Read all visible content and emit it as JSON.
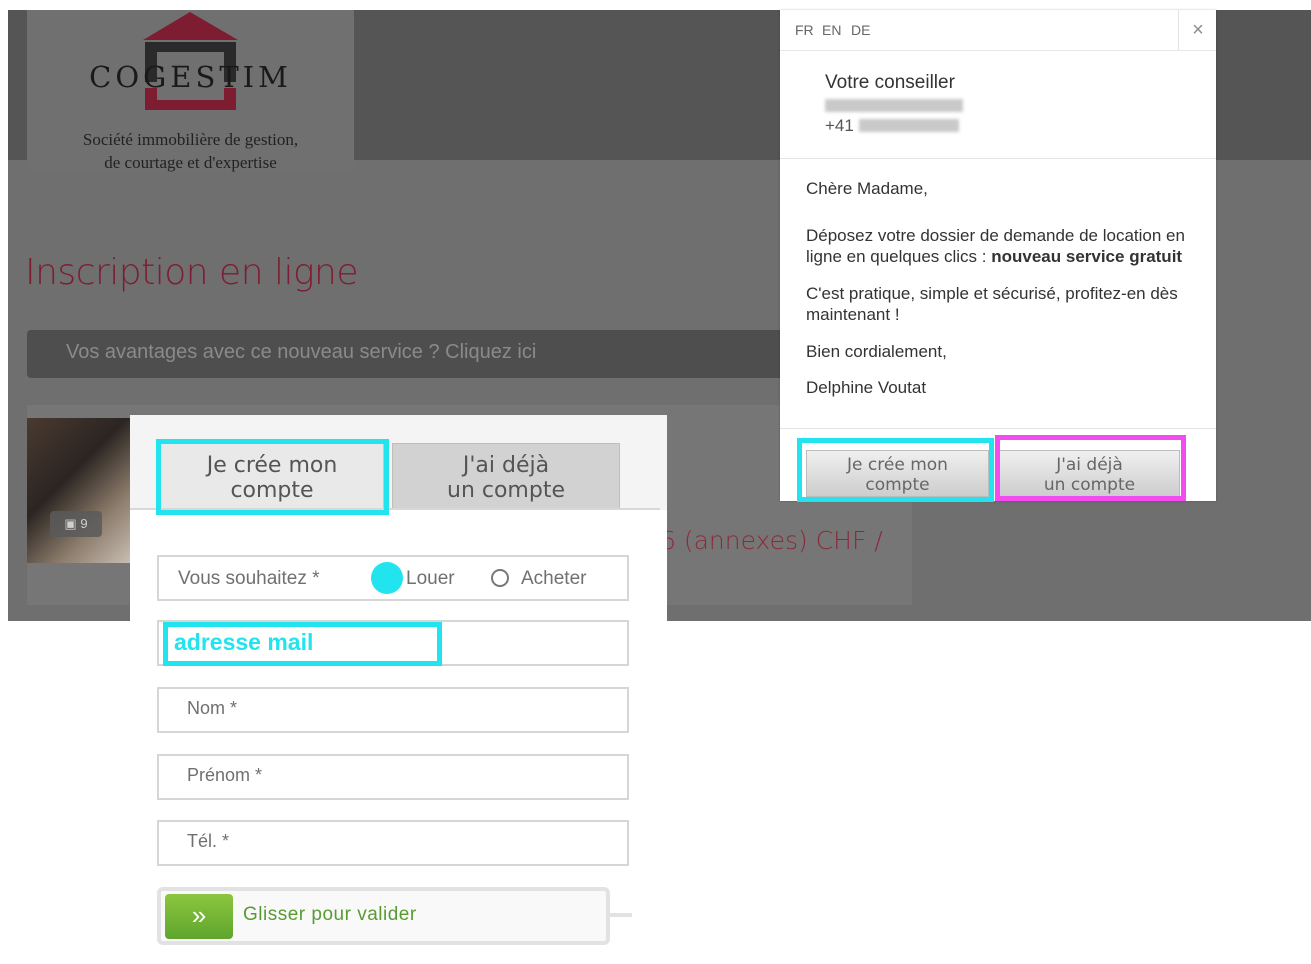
{
  "brand": {
    "name": "COGESTIM",
    "tagline_line1": "Société immobilière de gestion,",
    "tagline_line2": "de courtage et d'expertise",
    "color": "#7e1d31"
  },
  "page": {
    "title": "Inscription en ligne",
    "advantages_link": "Vos avantages avec ce nouveau service ? Cliquez ici"
  },
  "listing": {
    "photo_count": "9",
    "price_fragment": "6 (annexes) CHF /"
  },
  "form": {
    "tabs": {
      "create_line1": "Je crée mon",
      "create_line2": "compte",
      "existing_line1": "J'ai déjà",
      "existing_line2": "un compte"
    },
    "choice_label": "Vous souhaitez *",
    "option_rent": "Louer",
    "option_buy": "Acheter",
    "email_value": "adresse mail",
    "nom_label": "Nom *",
    "prenom_label": "Prénom *",
    "tel_label": "Tél. *",
    "slider_icon": "»",
    "slider_text": "Glisser pour valider"
  },
  "modal": {
    "languages": [
      "FR",
      "EN",
      "DE"
    ],
    "close": "×",
    "advisor_title": "Votre conseiller",
    "advisor_phone_prefix": "+41",
    "greeting": "Chère Madame,",
    "paragraph1_plain": "Déposez votre dossier de demande de location en ligne en quelques clics : ",
    "paragraph1_bold": "nouveau service gratuit",
    "paragraph2": "C'est pratique, simple et sécurisé, profitez-en dès maintenant !",
    "closing": "Bien cordialement,",
    "signature": "Delphine Voutat",
    "btn_create_line1": "Je crée mon",
    "btn_create_line2": "compte",
    "btn_existing_line1": "J'ai déjà",
    "btn_existing_line2": "un compte"
  },
  "highlight_colors": {
    "cyan": "#22e4ef",
    "pink": "#f04cf0"
  },
  "icons": {
    "camera": "camera-icon",
    "close": "close-icon",
    "slider": "double-chevron-right-icon"
  }
}
